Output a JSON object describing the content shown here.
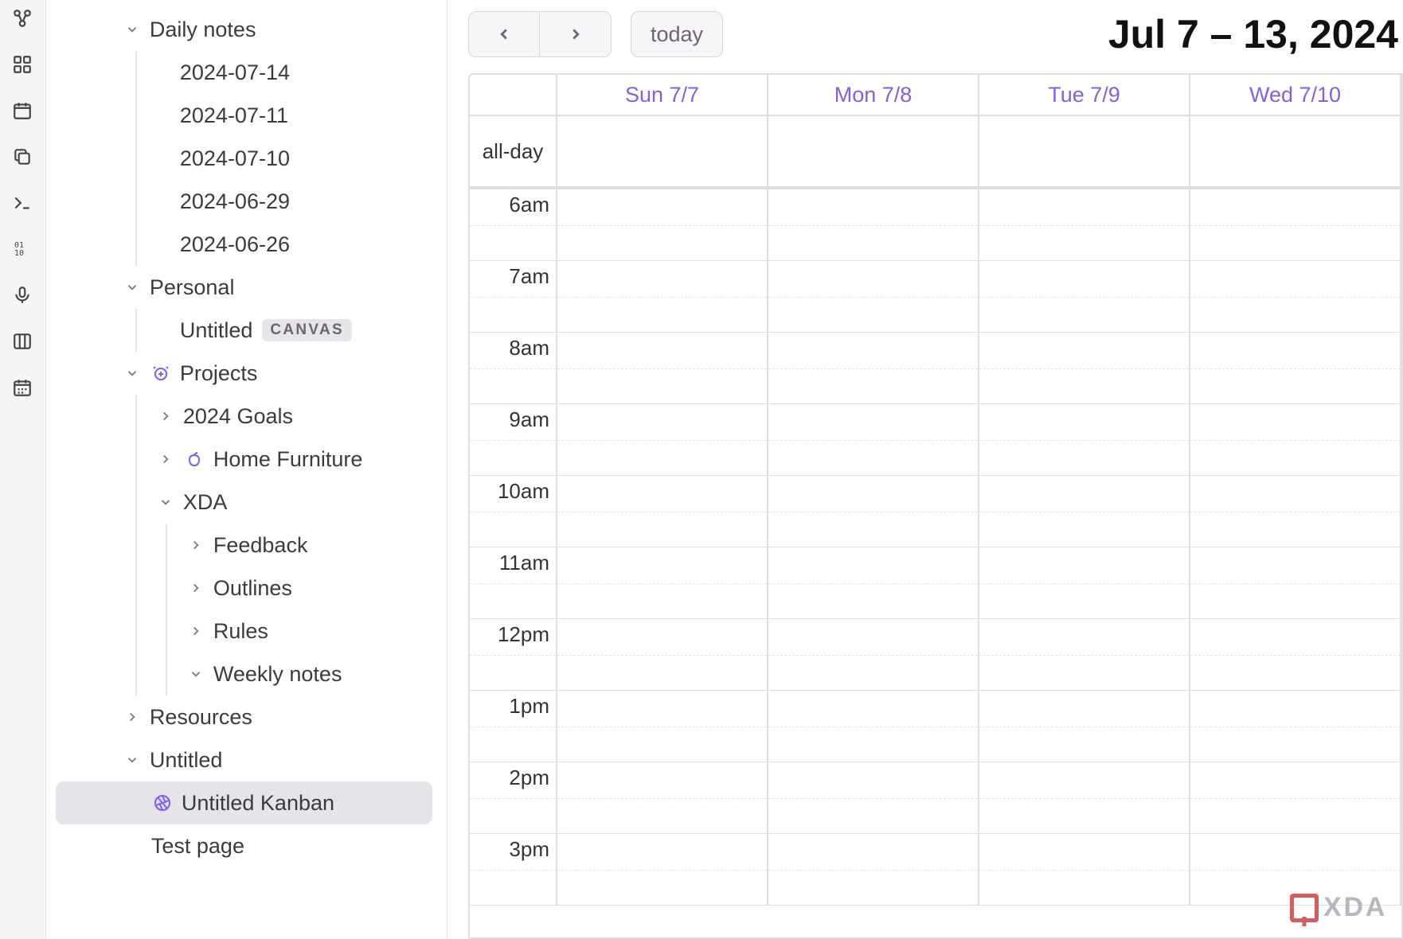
{
  "rail": [
    {
      "name": "graph-icon"
    },
    {
      "name": "grid-icon"
    },
    {
      "name": "calendar-icon"
    },
    {
      "name": "copy-icon"
    },
    {
      "name": "terminal-icon"
    },
    {
      "name": "binary-icon"
    },
    {
      "name": "mic-icon"
    },
    {
      "name": "board-icon"
    },
    {
      "name": "calendar-alt-icon"
    }
  ],
  "tree": {
    "daily_notes_label": "Daily notes",
    "daily_notes": [
      "2024-07-14",
      "2024-07-11",
      "2024-07-10",
      "2024-06-29",
      "2024-06-26"
    ],
    "personal_label": "Personal",
    "personal_untitled": "Untitled",
    "canvas_badge": "CANVAS",
    "projects_label": "Projects",
    "projects": {
      "goals": "2024 Goals",
      "home_furniture": "Home Furniture",
      "xda": "XDA",
      "xda_children": [
        "Feedback",
        "Outlines",
        "Rules",
        "Weekly notes"
      ]
    },
    "resources": "Resources",
    "untitled_folder": "Untitled",
    "untitled_kanban": "Untitled Kanban",
    "test_page": "Test page"
  },
  "calendar": {
    "today_label": "today",
    "title": "Jul 7 – 13, 2024",
    "days": [
      "Sun 7/7",
      "Mon 7/8",
      "Tue 7/9",
      "Wed 7/10"
    ],
    "allday_label": "all-day",
    "hours": [
      "6am",
      "7am",
      "8am",
      "9am",
      "10am",
      "11am",
      "12pm",
      "1pm",
      "2pm",
      "3pm"
    ]
  },
  "watermark": "XDA"
}
